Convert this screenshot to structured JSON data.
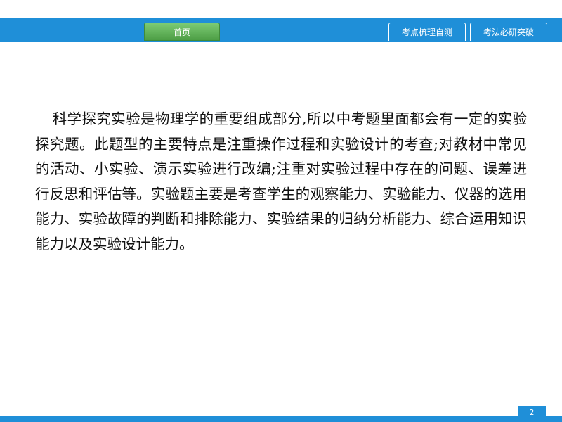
{
  "nav": {
    "home_label": "首页",
    "tab1_label": "考点梳理自测",
    "tab2_label": "考法必研突破"
  },
  "content": {
    "paragraph": "科学探究实验是物理学的重要组成部分,所以中考题里面都会有一定的实验探究题。此题型的主要特点是注重操作过程和实验设计的考查;对教材中常见的活动、小实验、演示实验进行改编;注重对实验过程中存在的问题、误差进行反思和评估等。实验题主要是考查学生的观察能力、实验能力、仪器的选用能力、实验故障的判断和排除能力、实验结果的归纳分析能力、综合运用知识能力以及实验设计能力。"
  },
  "footer": {
    "page_number": "2"
  },
  "colors": {
    "bar_blue": "#1f8fd8",
    "home_green": "#5aab52",
    "text": "#111111"
  }
}
